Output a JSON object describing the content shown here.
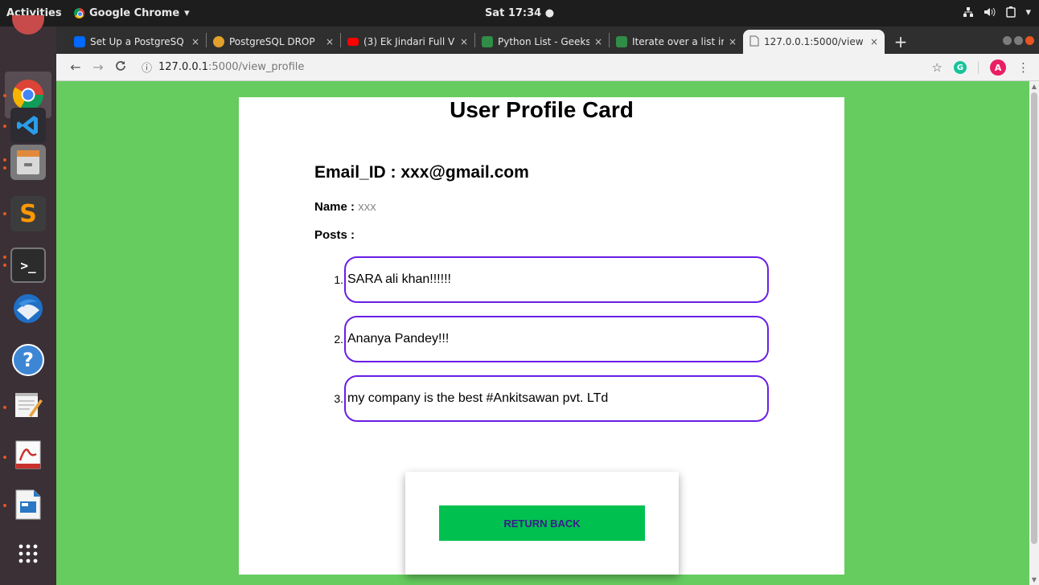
{
  "system": {
    "activities": "Activities",
    "app_name": "Google Chrome",
    "clock": "Sat 17:34 ●",
    "icons": [
      "network-icon",
      "volume-icon",
      "battery-icon",
      "system-menu-icon"
    ]
  },
  "browser": {
    "tabs": [
      {
        "title": "Set Up a PostgreSQ",
        "favicon": "digitalocean-icon",
        "color": "#0069ff"
      },
      {
        "title": "PostgreSQL DROP",
        "favicon": "postgres-icon",
        "color": "#e2a02c"
      },
      {
        "title": "(3) Ek Jindari Full V",
        "favicon": "youtube-icon",
        "color": "#ff0000"
      },
      {
        "title": "Python List - Geeks",
        "favicon": "geeksforgeeks-icon",
        "color": "#2f8d46"
      },
      {
        "title": "Iterate over a list ir",
        "favicon": "geeksforgeeks-icon",
        "color": "#2f8d46"
      },
      {
        "title": "127.0.0.1:5000/view",
        "favicon": "page-icon",
        "color": "#777777",
        "active": true
      }
    ],
    "new_tab": "+",
    "close_glyph": "×",
    "url_host": "127.0.0.1",
    "url_path": ":5000/view_profile",
    "info_glyph": "ⓘ",
    "avatar_letter": "A",
    "ext_letter": "G"
  },
  "page": {
    "title": "User Profile Card",
    "email_line": "Email_ID : xxx@gmail.com",
    "name_label": "Name :",
    "name_value": "xxx",
    "posts_label": "Posts :",
    "posts": [
      {
        "num": "1.",
        "text": "SARA ali khan!!!!!!"
      },
      {
        "num": "2.",
        "text": "Ananya Pandey!!!"
      },
      {
        "num": "3.",
        "text": "my company is the best #Ankitsawan pvt. LTd"
      }
    ],
    "return_label": "RETURN BACK"
  },
  "colors": {
    "page_bg": "#66cc5f",
    "post_border": "#6a1ee6",
    "button_bg": "#00c050",
    "button_text": "#3a1e8a"
  }
}
